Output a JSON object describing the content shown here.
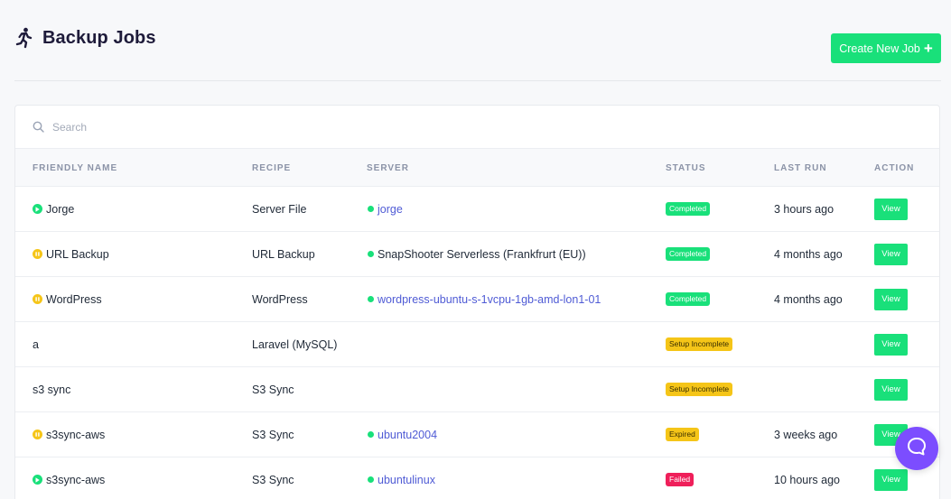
{
  "header": {
    "title": "Backup Jobs",
    "icon": "runner-icon",
    "create_button": "Create New Job"
  },
  "search": {
    "placeholder": "Search",
    "value": ""
  },
  "table": {
    "columns": [
      "FRIENDLY NAME",
      "RECIPE",
      "SERVER",
      "STATUS",
      "LAST RUN",
      "ACTION"
    ],
    "rows": [
      {
        "name": "Jorge",
        "state": "play",
        "recipe": "Server File",
        "server": "jorge",
        "server_style": "link",
        "status": "Completed",
        "status_type": "completed",
        "last_run": "3 hours ago",
        "action": "View"
      },
      {
        "name": "URL Backup",
        "state": "pause",
        "recipe": "URL Backup",
        "server": "SnapShooter Serverless (Frankfrurt (EU))",
        "server_style": "plain",
        "status": "Completed",
        "status_type": "completed",
        "last_run": "4 months ago",
        "action": "View"
      },
      {
        "name": "WordPress",
        "state": "pause",
        "recipe": "WordPress",
        "server": "wordpress-ubuntu-s-1vcpu-1gb-amd-lon1-01",
        "server_style": "link",
        "status": "Completed",
        "status_type": "completed",
        "last_run": "4 months ago",
        "action": "View"
      },
      {
        "name": "a",
        "state": "none",
        "recipe": "Laravel (MySQL)",
        "server": "",
        "server_style": "none",
        "status": "Setup Incomplete",
        "status_type": "setup",
        "last_run": "",
        "action": "View"
      },
      {
        "name": "s3 sync",
        "state": "none",
        "recipe": "S3 Sync",
        "server": "",
        "server_style": "none",
        "status": "Setup Incomplete",
        "status_type": "setup",
        "last_run": "",
        "action": "View"
      },
      {
        "name": "s3sync-aws",
        "state": "pause",
        "recipe": "S3 Sync",
        "server": "ubuntu2004",
        "server_style": "link",
        "status": "Expired",
        "status_type": "expired",
        "last_run": "3 weeks ago",
        "action": "View"
      },
      {
        "name": "s3sync-aws",
        "state": "play",
        "recipe": "S3 Sync",
        "server": "ubuntulinux",
        "server_style": "link",
        "status": "Failed",
        "status_type": "failed",
        "last_run": "10 hours ago",
        "action": "View"
      }
    ]
  },
  "colors": {
    "accent": "#19e07a",
    "link": "#4f5bd5",
    "warning": "#f5c518",
    "danger": "#ef1f5a",
    "chat": "#7c4dff"
  },
  "chat_widget": {
    "icon": "chat-bubble-icon"
  }
}
